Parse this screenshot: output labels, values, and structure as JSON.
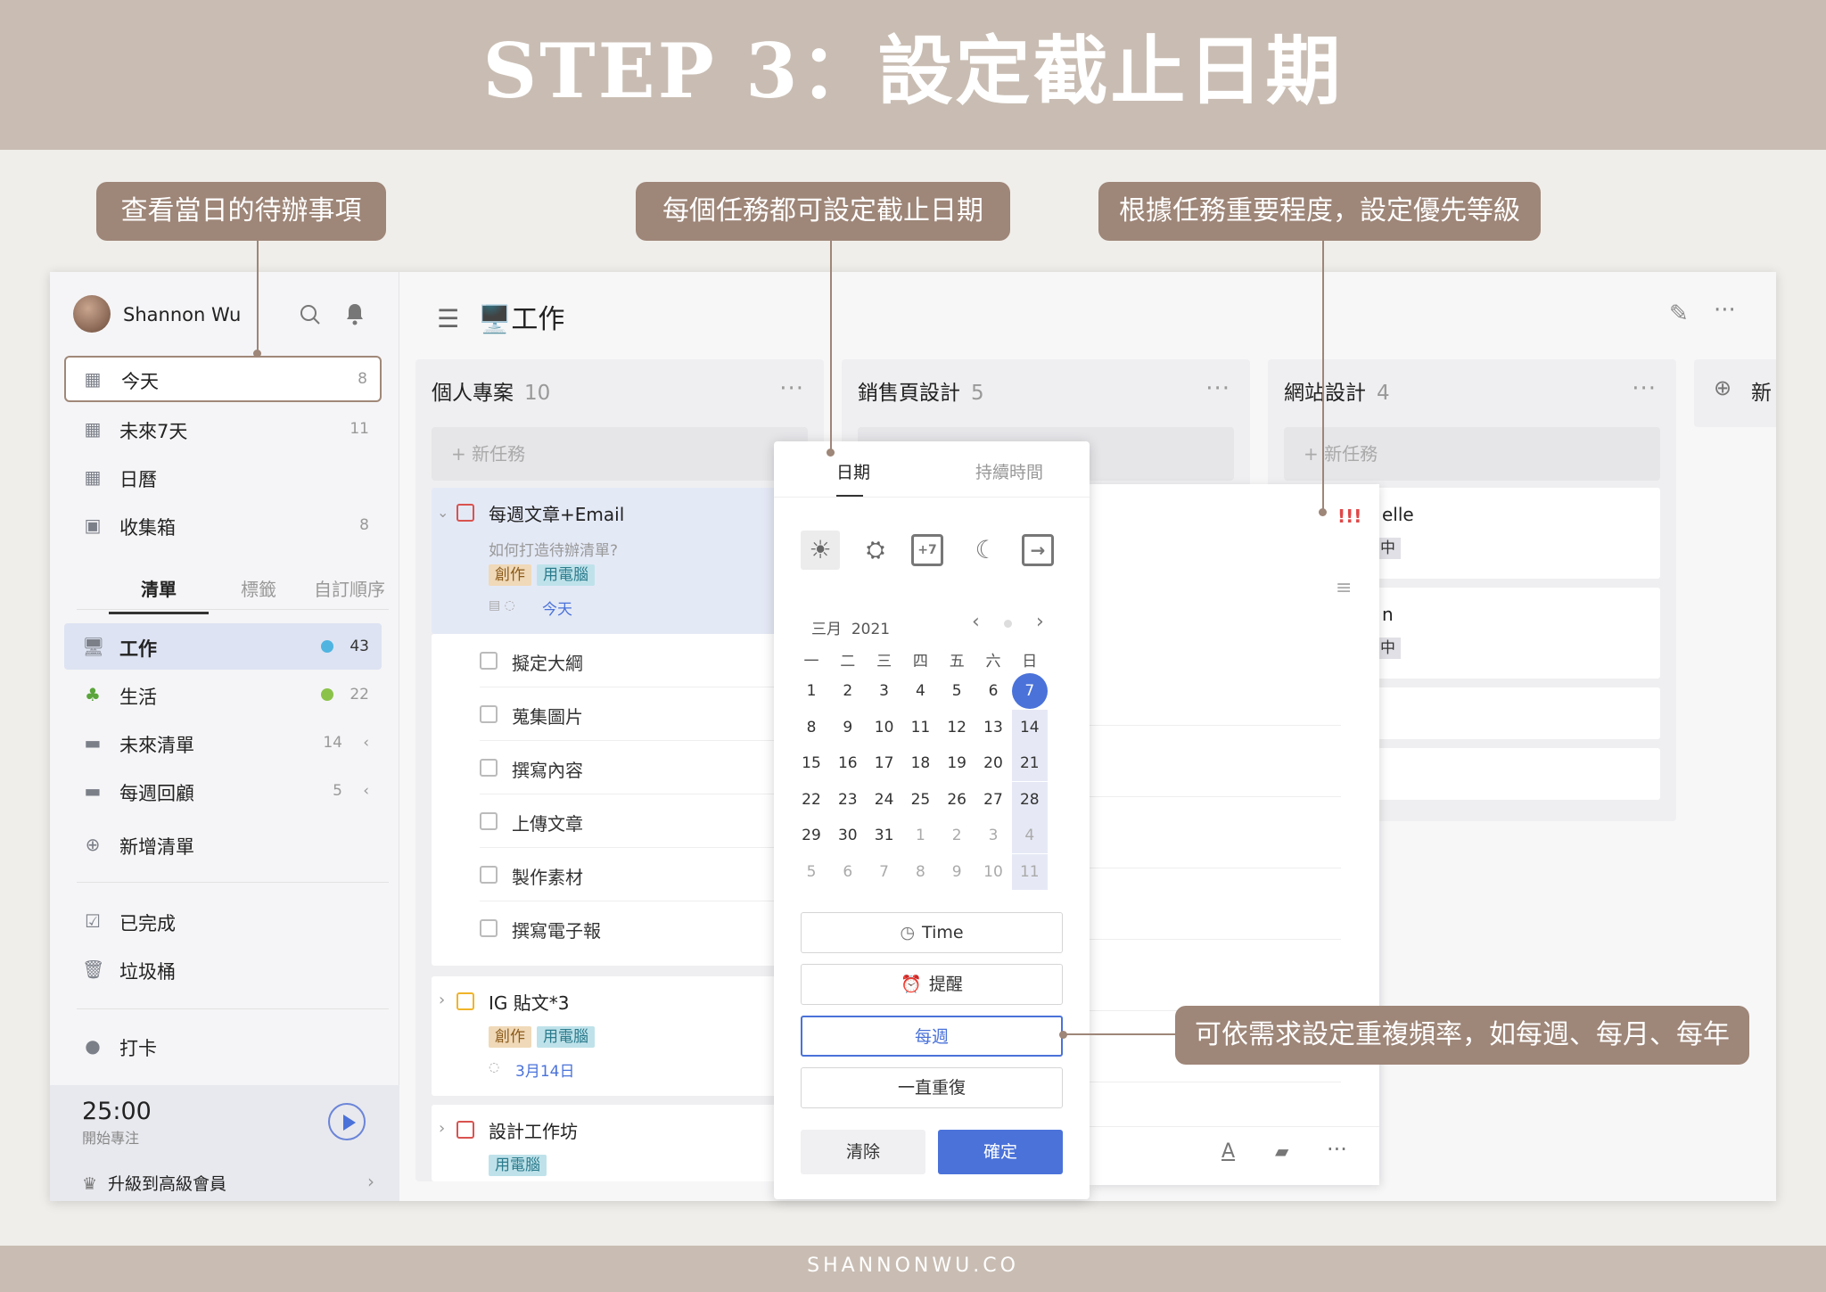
{
  "banner": {
    "title": "STEP 3：設定截止日期",
    "footer": "SHANNONWU.CO"
  },
  "callouts": {
    "today": "查看當日的待辦事項",
    "due": "每個任務都可設定截止日期",
    "priority": "根據任務重要程度，設定優先等級",
    "repeat": "可依需求設定重複頻率，如每週、每月、每年"
  },
  "sidebar": {
    "user": "Shannon Wu",
    "smart": [
      {
        "label": "今天",
        "count": "8",
        "icon": "calendar-7-icon"
      },
      {
        "label": "未來7天",
        "count": "11",
        "icon": "calendar-week-icon"
      },
      {
        "label": "日曆",
        "count": "",
        "icon": "calendar-grid-icon"
      },
      {
        "label": "收集箱",
        "count": "8",
        "icon": "inbox-icon"
      }
    ],
    "tabs": [
      "清單",
      "標籤",
      "自訂順序"
    ],
    "lists": [
      {
        "label": "工作",
        "count": "43",
        "color": "#4fb4e0",
        "icon": "monitor-icon"
      },
      {
        "label": "生活",
        "count": "22",
        "color": "#8bc34a",
        "icon": "sprout-icon"
      },
      {
        "label": "未來清單",
        "count": "14",
        "icon": "folder-icon"
      },
      {
        "label": "每週回顧",
        "count": "5",
        "icon": "folder-icon"
      }
    ],
    "add_list": "新增清單",
    "done": "已完成",
    "trash": "垃圾桶",
    "checkin": "打卡",
    "timer": "25:00",
    "timer_sub": "開始專注",
    "upgrade": "升級到高級會員"
  },
  "header": {
    "title": "🖥️工作"
  },
  "columns": [
    {
      "name": "個人專案",
      "count": "10"
    },
    {
      "name": "銷售頁設計",
      "count": "5"
    },
    {
      "name": "網站設計",
      "count": "4"
    },
    {
      "name": "新"
    }
  ],
  "new_task": "+ 新任務",
  "tasks": {
    "main": {
      "title": "每週文章+Email",
      "note": "如何打造待辦清單?",
      "tags": [
        "創作",
        "用電腦"
      ],
      "date": "今天"
    },
    "subs": [
      "擬定大綱",
      "蒐集圖片",
      "撰寫內容",
      "上傳文章",
      "製作素材",
      "撰寫電子報"
    ],
    "ig": {
      "title": "IG 貼文*3",
      "tags": [
        "創作",
        "用電腦"
      ],
      "date": "3月14日"
    },
    "workshop": {
      "title": "設計工作坊",
      "tags": [
        "用電腦"
      ]
    },
    "web1": {
      "title": "elle",
      "tag": "中"
    },
    "web2": {
      "title": "n",
      "tag": "中"
    }
  },
  "priority_mark": "!!!",
  "date_picker": {
    "tabs": [
      "日期",
      "持續時間"
    ],
    "month": "三月",
    "year": "2021",
    "weekdays": [
      "一",
      "二",
      "三",
      "四",
      "五",
      "六",
      "日"
    ],
    "weeks": [
      [
        "1",
        "2",
        "3",
        "4",
        "5",
        "6",
        "7"
      ],
      [
        "8",
        "9",
        "10",
        "11",
        "12",
        "13",
        "14"
      ],
      [
        "15",
        "16",
        "17",
        "18",
        "19",
        "20",
        "21"
      ],
      [
        "22",
        "23",
        "24",
        "25",
        "26",
        "27",
        "28"
      ],
      [
        "29",
        "30",
        "31",
        "1",
        "2",
        "3",
        "4"
      ],
      [
        "5",
        "6",
        "7",
        "8",
        "9",
        "10",
        "11"
      ]
    ],
    "selected": "7",
    "quick_icons": [
      "sun-icon",
      "sunrise-icon",
      "plus7-calendar-icon",
      "moon-icon",
      "next-arrow-calendar-icon"
    ],
    "plus7": "+7",
    "time": "Time",
    "reminder": "提醒",
    "repeat": "每週",
    "repeat_end": "一直重復",
    "clear": "清除",
    "ok": "確定",
    "accent": "#4a72d9"
  }
}
